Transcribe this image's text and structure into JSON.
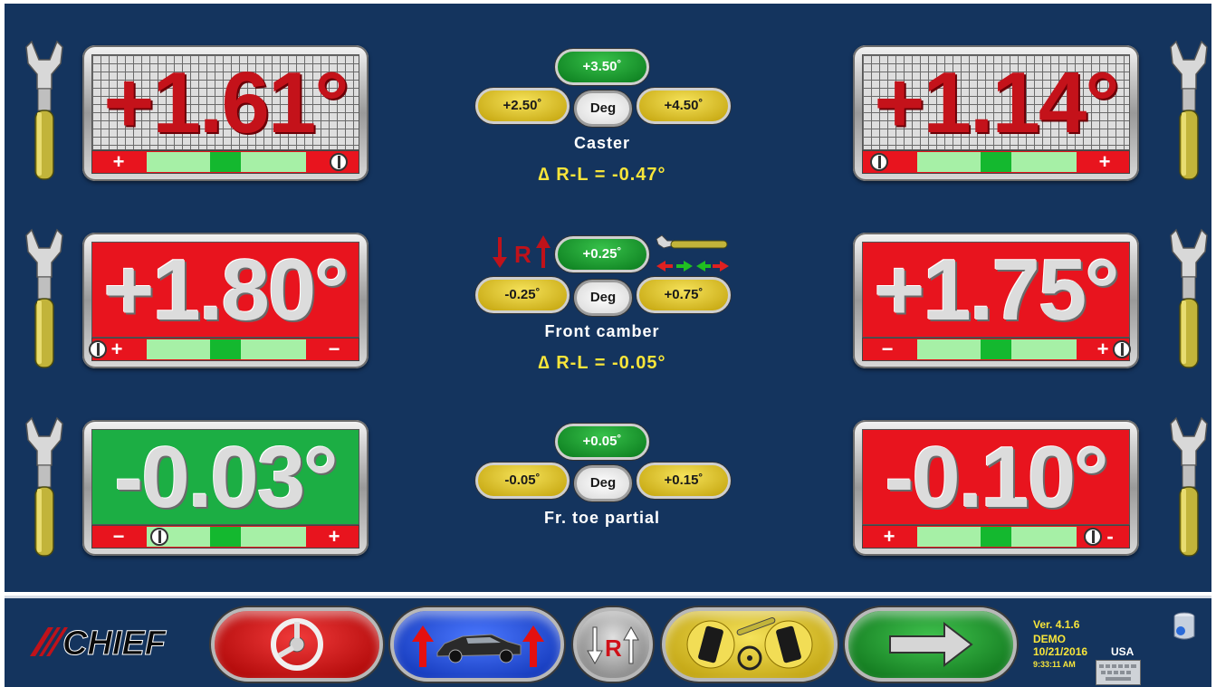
{
  "readings": {
    "caster_left": "+1.61°",
    "caster_right": "+1.14°",
    "camber_left": "+1.80°",
    "camber_right": "+1.75°",
    "toe_left": "-0.03°",
    "toe_right": "-0.10°"
  },
  "bar_signs": {
    "caster_left": [
      "+",
      ""
    ],
    "caster_right": [
      "",
      "+"
    ],
    "camber_left": [
      "+",
      "−"
    ],
    "camber_right": [
      "−",
      "+"
    ],
    "toe_left": [
      "−",
      "+"
    ],
    "toe_right": [
      "+",
      "-"
    ]
  },
  "caster": {
    "top": "+3.50˚",
    "left": "+2.50˚",
    "center": "Deg",
    "right": "+4.50˚",
    "label": "Caster",
    "delta": "∆ R-L = -0.47°"
  },
  "camber": {
    "top": "+0.25˚",
    "left": "-0.25˚",
    "center": "Deg",
    "right": "+0.75˚",
    "label": "Front camber",
    "delta": "∆ R-L = -0.05°",
    "r_icon_letter": "R"
  },
  "toe": {
    "top": "+0.05˚",
    "left": "-0.05˚",
    "center": "Deg",
    "right": "+0.15˚",
    "label": "Fr. toe partial"
  },
  "footer": {
    "brand": "CHIEF",
    "version": "Ver. 4.1.6",
    "mode": "DEMO",
    "date": "10/21/2016",
    "region": "USA",
    "time": "9:33:11 AM",
    "r_button_letter": "R"
  },
  "colors": {
    "background": "#14345e",
    "reading_red": "#e8141e",
    "reading_green": "#1cae44",
    "accent_yellow": "#f8e53a"
  },
  "icons": [
    "wrench-icon",
    "steering-wheel-icon",
    "car-raise-icon",
    "rear-reference-icon",
    "wheel-adjust-icon",
    "next-arrow-icon",
    "keyboard-icon",
    "database-icon"
  ]
}
